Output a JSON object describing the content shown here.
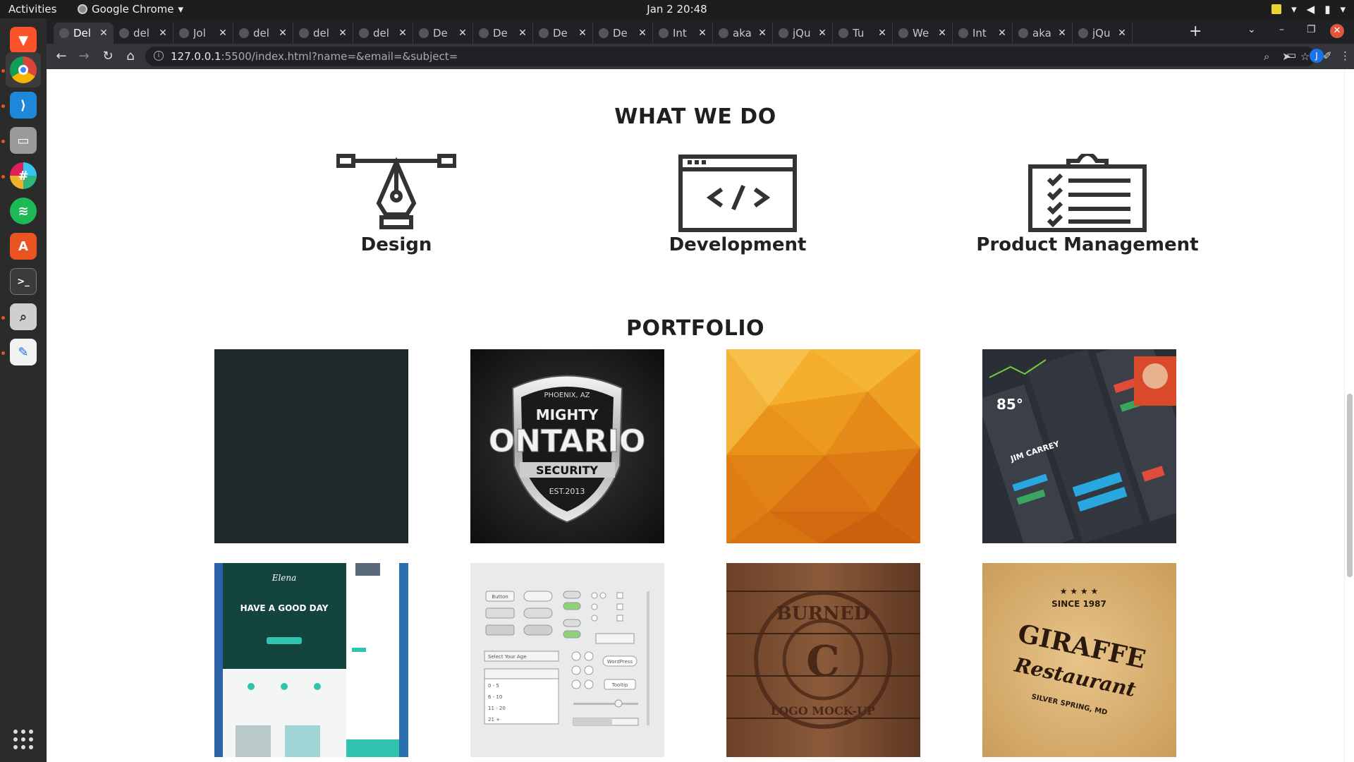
{
  "system": {
    "activities": "Activities",
    "app_name": "Google Chrome",
    "clock": "Jan 2  20:48"
  },
  "browser": {
    "tabs": [
      {
        "title": "Del",
        "active": true
      },
      {
        "title": "del"
      },
      {
        "title": "Jol"
      },
      {
        "title": "del"
      },
      {
        "title": "del"
      },
      {
        "title": "del"
      },
      {
        "title": "De"
      },
      {
        "title": "De"
      },
      {
        "title": "De"
      },
      {
        "title": "De"
      },
      {
        "title": "Int"
      },
      {
        "title": "aka"
      },
      {
        "title": "jQu"
      },
      {
        "title": "Tu"
      },
      {
        "title": "We"
      },
      {
        "title": "Int"
      },
      {
        "title": "aka"
      },
      {
        "title": "jQu"
      }
    ],
    "url_host": "127.0.0.1",
    "url_rest": ":5500/index.html?name=&email=&subject=",
    "profile_initial": "J"
  },
  "page": {
    "what_we_do": {
      "title": "WHAT WE DO",
      "services": [
        {
          "label": "Design",
          "icon": "pen-tool-icon"
        },
        {
          "label": "Development",
          "icon": "code-window-icon"
        },
        {
          "label": "Product Management",
          "icon": "clipboard-checklist-icon"
        }
      ]
    },
    "portfolio": {
      "title": "PORTFOLIO",
      "items": [
        {
          "name": "dark-teal-tile",
          "color": "#1f2b2b"
        },
        {
          "name": "mighty-ontario-logo",
          "text_top": "PHOENIX, AZ",
          "text_main1": "MIGHTY",
          "text_main2": "ONTARIO",
          "text_band": "SECURITY",
          "text_est": "EST.2013"
        },
        {
          "name": "orange-polygon-tile",
          "color": "#f0a020"
        },
        {
          "name": "dark-ui-kit",
          "text_temp": "85°",
          "text_name": "JIM CARREY"
        },
        {
          "name": "website-mockup",
          "text_brand": "Elena",
          "text_headline": "HAVE A GOOD DAY"
        },
        {
          "name": "ui-controls-kit",
          "btn": "Button",
          "select": "Select Your Age",
          "opts": [
            "0 - 5",
            "6 - 10",
            "11 - 20",
            "21 +"
          ],
          "tag": "WordPress",
          "tooltip": "Tooltip"
        },
        {
          "name": "burned-logo-mockup",
          "text_top": "BURNED",
          "text_bottom": "LOGO MOCK-UP",
          "text_center": "C"
        },
        {
          "name": "giraffe-restaurant-logo",
          "text_since": "SINCE 1987",
          "text_main": "GIRAFFE",
          "text_script": "Restaurant",
          "text_loc": "SILVER SPRING, MD"
        }
      ]
    }
  },
  "colors": {
    "accent_orange": "#e95420",
    "chrome_dark": "#202124",
    "text_dark": "#222222"
  }
}
